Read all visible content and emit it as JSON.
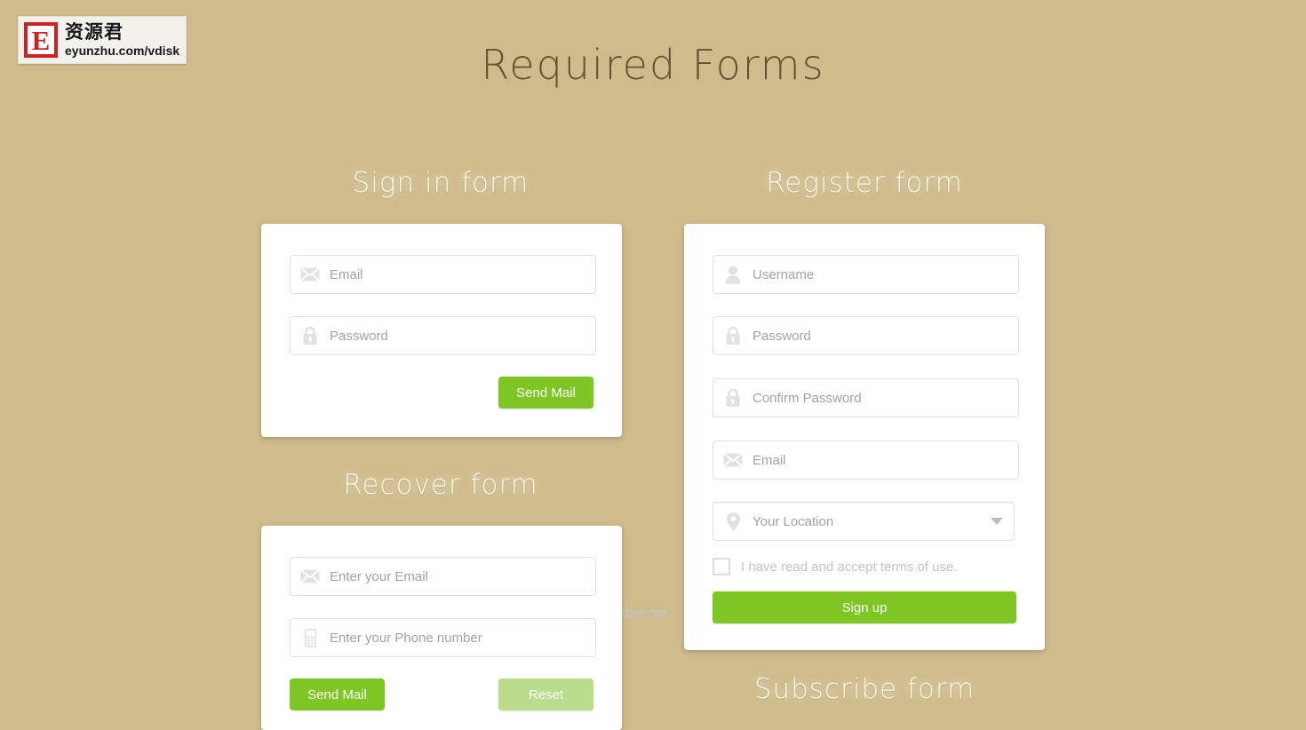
{
  "page": {
    "title": "Required Forms",
    "background_color": "#cfbc8d",
    "accent_green": "#7ec624",
    "accent_green_light": "#b9dd8a"
  },
  "watermark": {
    "badge_letter": "E",
    "cn_text": "资源君",
    "url_text": "eyunzhu.com/vdisk"
  },
  "signin": {
    "heading": "Sign in form",
    "email": {
      "placeholder": "Email",
      "value": "",
      "icon": "mail-icon"
    },
    "password": {
      "placeholder": "Password",
      "value": "",
      "icon": "lock-icon"
    },
    "remember": {
      "label": "Remember me",
      "checked": false
    },
    "submit_label": "Send Mail"
  },
  "recover": {
    "heading": "Recover form",
    "email": {
      "placeholder": "Enter your Email",
      "value": "",
      "icon": "mail-icon"
    },
    "phone": {
      "placeholder": "Enter your Phone number",
      "value": "",
      "icon": "phone-icon"
    },
    "send_label": "Send Mail",
    "reset_label": "Reset"
  },
  "register": {
    "heading": "Register form",
    "username": {
      "placeholder": "Username",
      "value": "",
      "icon": "user-icon"
    },
    "password": {
      "placeholder": "Password",
      "value": "",
      "icon": "lock-icon"
    },
    "confirm_password": {
      "placeholder": "Confirm Password",
      "value": "",
      "icon": "lock-icon"
    },
    "email": {
      "placeholder": "Email",
      "value": "",
      "icon": "mail-icon"
    },
    "location": {
      "placeholder": "Your Location",
      "value": "",
      "icon": "location-pin-icon",
      "caret": "chevron-down-icon"
    },
    "terms": {
      "label": "I have read and accept terms of use.",
      "checked": false
    },
    "submit_label": "Sign up"
  },
  "next_section": {
    "heading": "Subscribe form"
  }
}
